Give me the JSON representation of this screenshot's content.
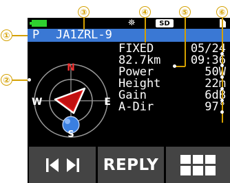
{
  "callouts": [
    "①",
    "②",
    "③",
    "④",
    "⑤",
    "⑥"
  ],
  "status": {
    "gps_icon": "satellite-icon",
    "sd_label": "SD",
    "memo_icon": "memo-icon",
    "battery_color": "#2fd12f"
  },
  "title": {
    "prefix": "P",
    "callsign": "JA1ZRL-9",
    "bg_color": "#3a78d4"
  },
  "compass": {
    "north": "N",
    "south": "S",
    "east": "E",
    "west": "W"
  },
  "info": {
    "status": "FIXED",
    "date": "05/24",
    "distance": "82.7km",
    "time": "09:36",
    "rows": [
      {
        "label": "Power",
        "value": "50W"
      },
      {
        "label": "Height",
        "value": "22m"
      },
      {
        "label": "Gain",
        "value": "6dB"
      },
      {
        "label": "A-Dir",
        "value": "97°"
      }
    ]
  },
  "buttons": {
    "prev_next": "◀ ▶",
    "reply": "REPLY",
    "menu_icon": "grid-icon"
  }
}
